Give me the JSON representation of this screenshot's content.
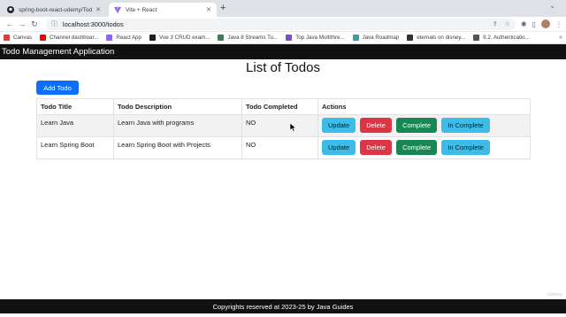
{
  "browser": {
    "tabs": [
      {
        "title": "spring-boot-react-udemy/Todo",
        "icon": "github-icon",
        "active": false
      },
      {
        "title": "Vite + React",
        "icon": "vite-icon",
        "active": true
      }
    ],
    "url": "localhost:3000/todos",
    "bookmarks": [
      {
        "label": "Canvas",
        "icon": "canvas-icon",
        "color": "#e23c35"
      },
      {
        "label": "Channel dashboar...",
        "icon": "youtube-icon",
        "color": "#ff0000"
      },
      {
        "label": "React App",
        "icon": "vite-icon",
        "color": "#8a63ff"
      },
      {
        "label": "Vue 3 CRUD exam...",
        "icon": "site-icon",
        "color": "#202124"
      },
      {
        "label": "Java 8 Streams Tu...",
        "icon": "site-icon",
        "color": "#3f7d5a"
      },
      {
        "label": "Top Java Multithre...",
        "icon": "site-icon",
        "color": "#7b4fc8"
      },
      {
        "label": "Java Roadmap",
        "icon": "site-icon",
        "color": "#34a0a4"
      },
      {
        "label": "eternals on disney...",
        "icon": "site-icon",
        "color": "#333333"
      },
      {
        "label": "9.2. Authenticatio...",
        "icon": "site-icon",
        "color": "#555555"
      }
    ]
  },
  "app": {
    "brand": "Todo Management Application",
    "page_title": "List of Todos",
    "add_button": "Add Todo",
    "table": {
      "headers": [
        "Todo Title",
        "Todo Description",
        "Todo Completed",
        "Actions"
      ],
      "rows": [
        {
          "title": "Learn Java",
          "description": "Learn Java with programs",
          "completed": "NO"
        },
        {
          "title": "Learn Spring Boot",
          "description": "Learn Spring Boot with Projects",
          "completed": "NO"
        }
      ],
      "actions": {
        "update": "Update",
        "delete": "Delete",
        "complete": "Complete",
        "incomplete": "In Complete"
      }
    },
    "footer": "Copyrights reserved at 2023-25 by Java Guides",
    "watermark": "Udemy"
  },
  "colors": {
    "primary": "#0d6efd",
    "info": "#3dbce8",
    "danger": "#dc3545",
    "success": "#198754",
    "dark": "#111111"
  }
}
